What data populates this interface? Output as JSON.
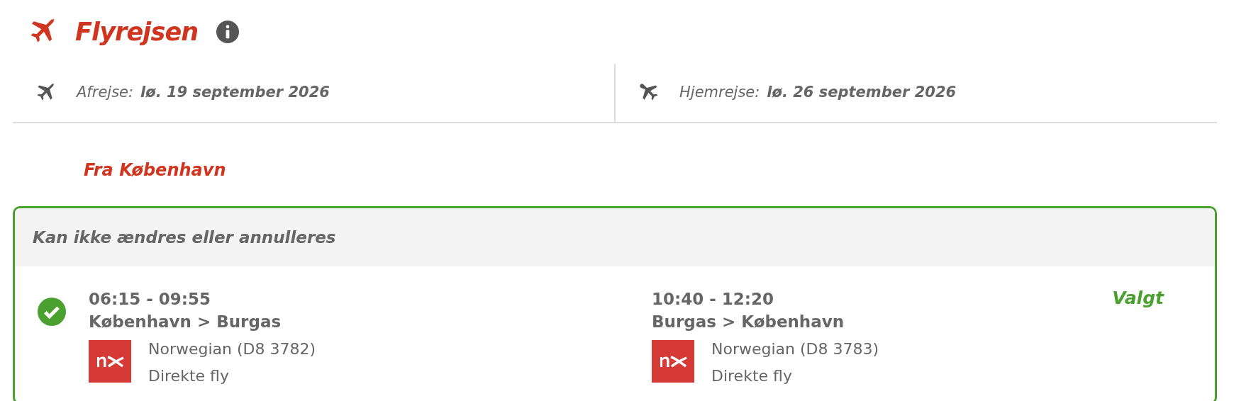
{
  "section": {
    "title": "Flyrejsen"
  },
  "dates": [
    {
      "kind": "departure",
      "label": "Afrejse:",
      "value": "lø. 19 september 2026"
    },
    {
      "kind": "return",
      "label": "Hjemrejse:",
      "value": "lø. 26 september 2026"
    }
  ],
  "origin": "Fra København",
  "option": {
    "header": "Kan ikke ændres eller annulleres",
    "selected": true,
    "status": "Valgt",
    "legs": [
      {
        "times": "06:15 - 09:55",
        "route": "København > Burgas",
        "airline": "Norwegian (D8 3782)",
        "type": "Direkte fly"
      },
      {
        "times": "10:40 - 12:20",
        "route": "Burgas > København",
        "airline": "Norwegian (D8 3783)",
        "type": "Direkte fly"
      }
    ]
  }
}
